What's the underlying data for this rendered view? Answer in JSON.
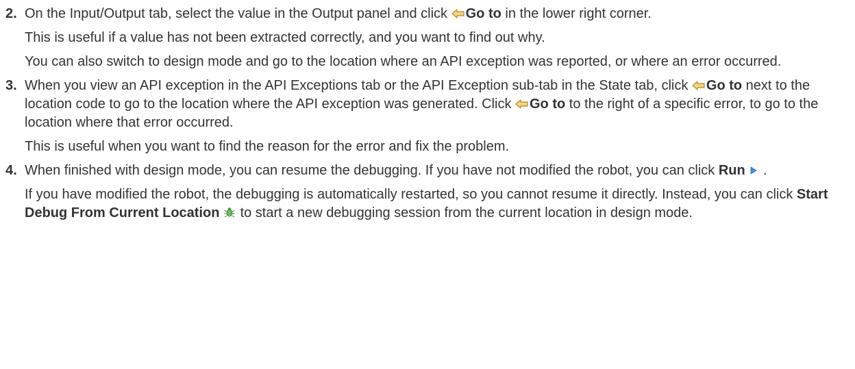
{
  "steps": [
    {
      "number": "2.",
      "main": {
        "t1": "On the Input/Output tab, select the value in the Output panel and click ",
        "b1": "Go to",
        "t2": " in the lower right corner."
      },
      "follow": [
        "This is useful if a value has not been extracted correctly, and you want to find out why.",
        "You can also switch to design mode and go to the location where an API exception was reported, or where an error occurred."
      ]
    },
    {
      "number": "3.",
      "main": {
        "t1": "When you view an API exception in the API Exceptions tab or the API Exception sub-tab in the State tab, click ",
        "b1": "Go to",
        "t2": " next to the location code to go to the location where the API exception was generated. Click ",
        "b2": "Go to",
        "t3": " to the right of a specific error, to go to the location where that error occurred."
      },
      "follow": [
        "This is useful when you want to find the reason for the error and fix the problem."
      ]
    },
    {
      "number": "4.",
      "main": {
        "t1": "When finished with design mode, you can resume the debugging. If you have not modified the robot, you can click ",
        "b1": "Run",
        "t2": " ."
      },
      "follow_rich": {
        "t1": "If you have modified the robot, the debugging is automatically restarted, so you cannot resume it directly. Instead, you can click ",
        "b1": "Start Debug From Current Location",
        "t2": " to start a new debugging session from the current location in design mode."
      }
    }
  ],
  "icons": {
    "goto": "goto-arrow-icon",
    "run": "run-play-icon",
    "start_debug": "start-debug-bug-icon"
  },
  "colors": {
    "text": "#333333",
    "goto_icon_fill": "#f3d77a",
    "goto_icon_stroke": "#b48a2c",
    "run_icon": "#4a90d9",
    "debug_icon": "#3d9a3d"
  }
}
